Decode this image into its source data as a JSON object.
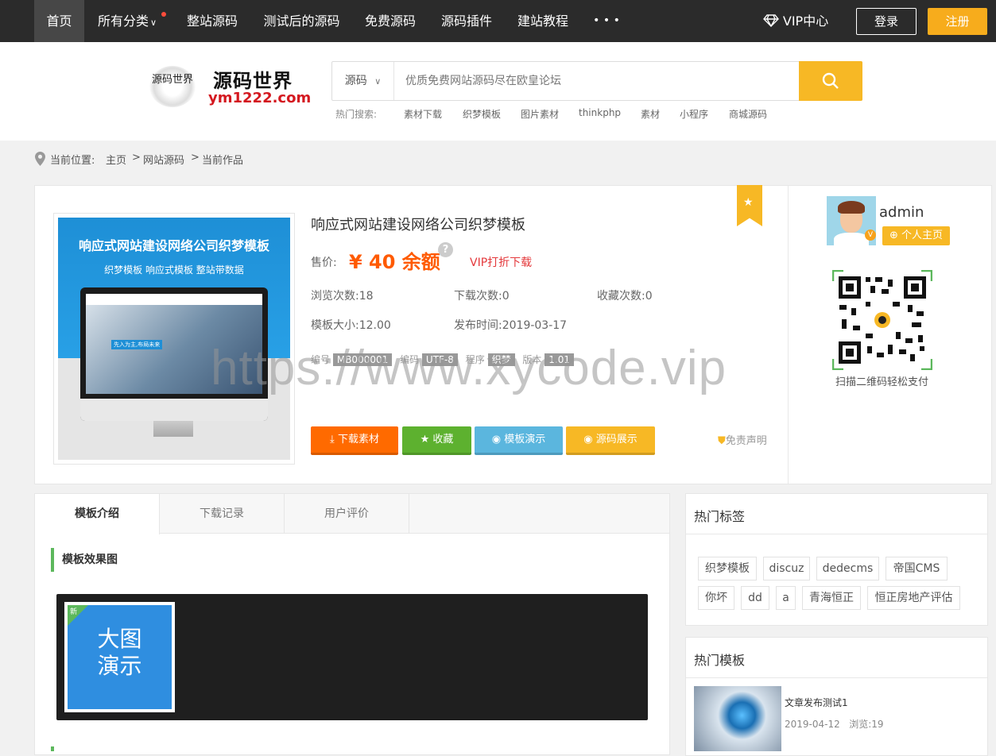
{
  "nav": {
    "items": [
      "首页",
      "所有分类",
      "整站源码",
      "测试后的源码",
      "免费源码",
      "源码插件",
      "建站教程"
    ],
    "more": "• • •",
    "vip": "VIP中心",
    "login": "登录",
    "register": "注册"
  },
  "logo": {
    "title": "源码世界",
    "domain": "ym1222.com",
    "seal": "源码世界"
  },
  "search": {
    "category": "源码",
    "placeholder": "优质免费网站源码尽在欧皇论坛",
    "hot_label": "热门搜索:",
    "hot": [
      "素材下载",
      "织梦模板",
      "图片素材",
      "thinkphp",
      "素材",
      "小程序",
      "商城源码"
    ]
  },
  "breadcrumb": {
    "label": "当前位置:",
    "items": [
      "主页",
      "网站源码",
      "当前作品"
    ],
    "sep": ">"
  },
  "product": {
    "title": "响应式网站建设网络公司织梦模板",
    "price_label": "售价:",
    "price": "¥ 40 余额",
    "help": "?",
    "vip_discount": "VIP打折下载",
    "stats": [
      {
        "label": "浏览次数:",
        "value": "18"
      },
      {
        "label": "下载次数:",
        "value": "0"
      },
      {
        "label": "收藏次数:",
        "value": "0"
      },
      {
        "label": "模板大小:",
        "value": "12.00"
      },
      {
        "label": "发布时间:",
        "value": "2019-03-17"
      }
    ],
    "meta": [
      {
        "label": "编号",
        "value": "MB000001"
      },
      {
        "label": "编码",
        "value": "UTF-8"
      },
      {
        "label": "程序",
        "value": "织梦"
      },
      {
        "label": "版本",
        "value": "1.01"
      }
    ],
    "thumb": {
      "heading": "响应式网站建设网络公司织梦模板",
      "sub": "织梦模板  响应式模板 整站带数据",
      "banner": "先入为主,布局未来"
    },
    "buttons": [
      "下载素材",
      "收藏",
      "模板演示",
      "源码展示"
    ],
    "disclaimer": "免责声明",
    "watermark": "https://www.xycode.vip"
  },
  "author": {
    "name": "admin",
    "home": "个人主页",
    "qr_caption": "扫描二维码轻松支付"
  },
  "tabs": [
    "模板介绍",
    "下载记录",
    "用户评价"
  ],
  "content": {
    "section_title": "模板效果图",
    "preview": "大图\n演示",
    "preview_badge": "新"
  },
  "hot_tags": {
    "title": "热门标签",
    "tags": [
      "织梦模板",
      "discuz",
      "dedecms",
      "帝国CMS",
      "你坏",
      "dd",
      "a",
      "青海恒正",
      "恒正房地产评估"
    ]
  },
  "hot_templates": {
    "title": "热门模板",
    "items": [
      {
        "title": "文章发布测试1",
        "date": "2019-04-12",
        "views_label": "浏览:",
        "views": "19"
      }
    ]
  },
  "colors": {
    "accent": "#f7b825",
    "price": "#ff5a00",
    "nav_bg": "#2b2b2b",
    "green": "#5cb85c",
    "blue": "#5bc0de"
  }
}
